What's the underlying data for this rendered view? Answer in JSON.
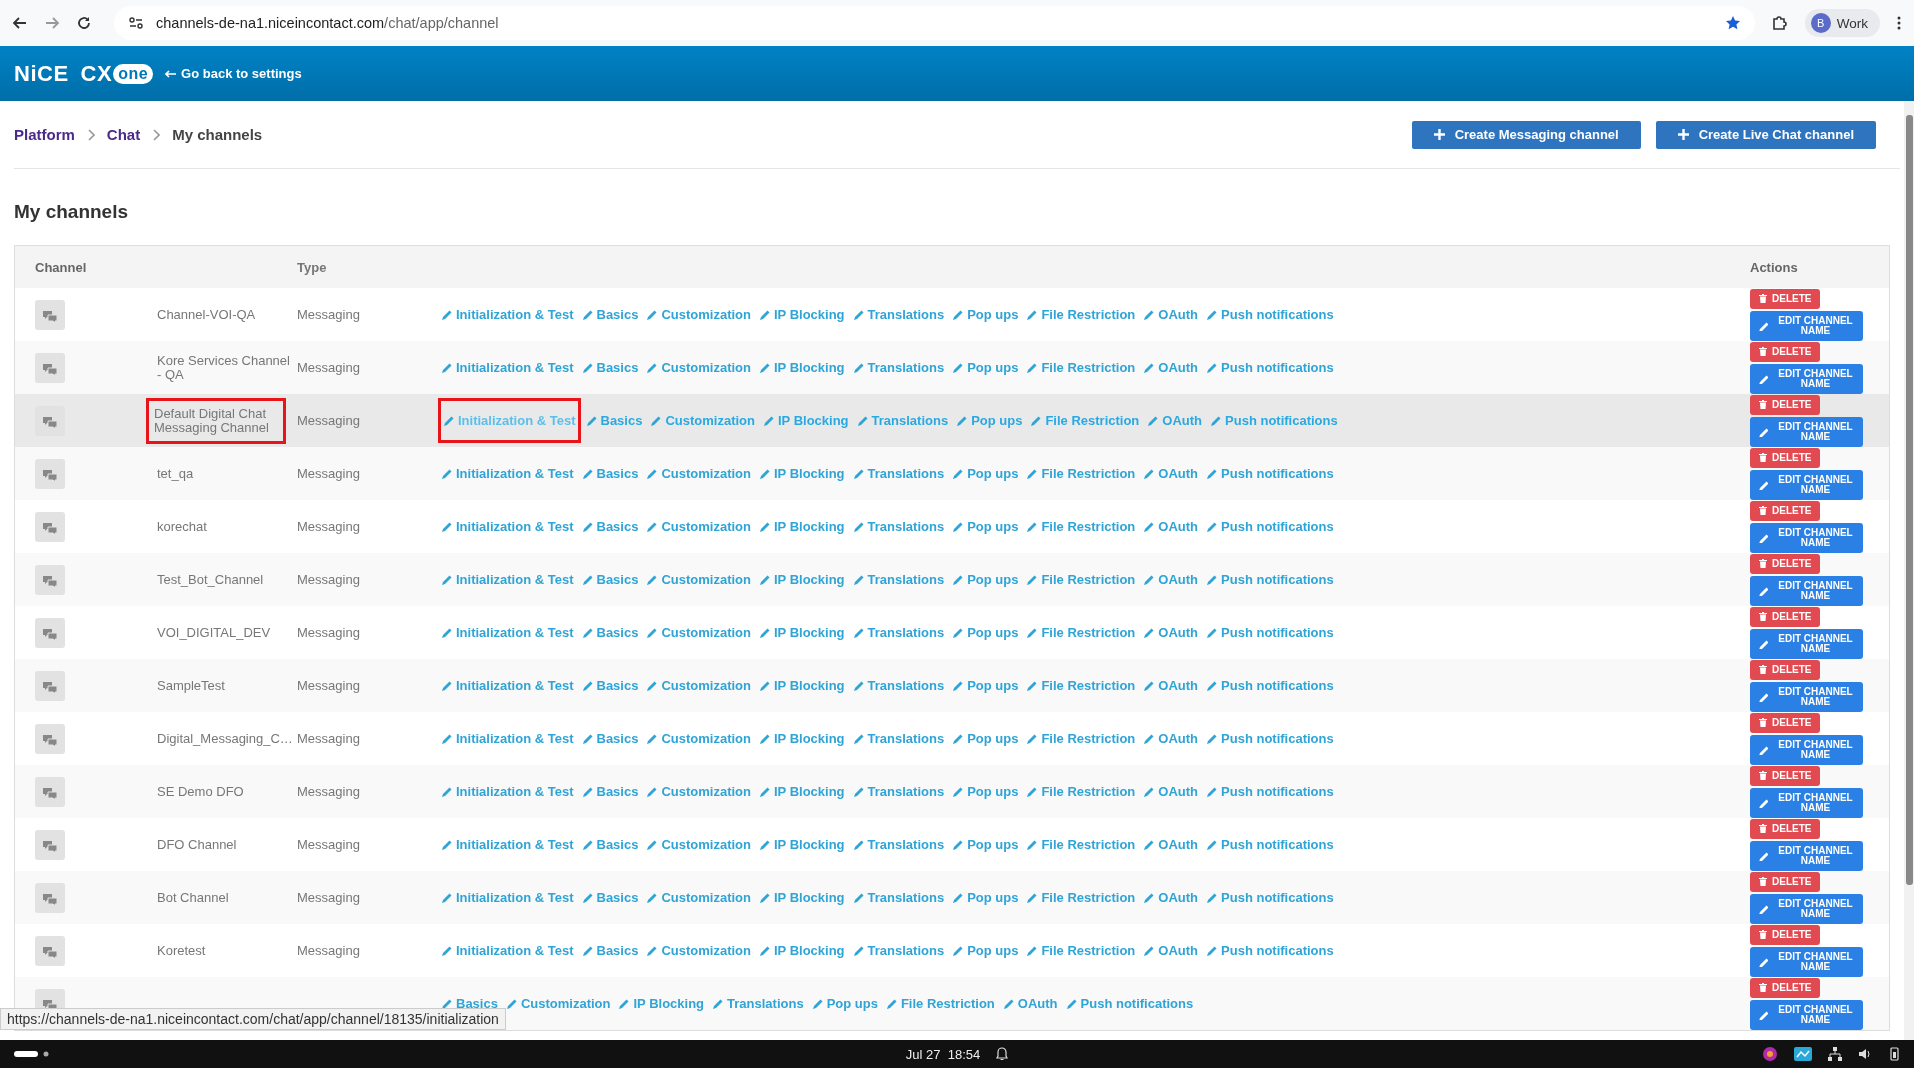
{
  "browser": {
    "url_host": "channels-de-na1.niceincontact.com",
    "url_path": "/chat/app/channel",
    "profile_initial": "B",
    "profile_name": "Work"
  },
  "header": {
    "logo_nice": "NiCE",
    "logo_cx": "CX",
    "logo_one": "one",
    "back_link": "Go back to settings"
  },
  "breadcrumb": [
    {
      "label": "Platform",
      "current": false
    },
    {
      "label": "Chat",
      "current": false
    },
    {
      "label": "My channels",
      "current": true
    }
  ],
  "create_buttons": [
    "Create Messaging channel",
    "Create Live Chat channel"
  ],
  "page_title": "My channels",
  "table": {
    "columns": [
      "Channel",
      "Type",
      "Actions"
    ],
    "rows": [
      {
        "name": "Channel-VOI-QA",
        "type": "Messaging",
        "hovered": false,
        "marked": false,
        "links": [
          "Initialization & Test",
          "Basics",
          "Customization",
          "IP Blocking",
          "Translations",
          "Pop ups",
          "File Restriction",
          "OAuth",
          "Push notifications"
        ],
        "delete": "DELETE",
        "edit": "EDIT CHANNEL NAME"
      },
      {
        "name": "Kore Services Channel - QA",
        "type": "Messaging",
        "hovered": false,
        "marked": false,
        "links": [
          "Initialization & Test",
          "Basics",
          "Customization",
          "IP Blocking",
          "Translations",
          "Pop ups",
          "File Restriction",
          "OAuth",
          "Push notifications"
        ],
        "delete": "DELETE",
        "edit": "EDIT CHANNEL NAME"
      },
      {
        "name": "Default Digital Chat Messaging Channel",
        "type": "Messaging",
        "hovered": true,
        "marked": true,
        "links": [
          "Initialization & Test",
          "Basics",
          "Customization",
          "IP Blocking",
          "Translations",
          "Pop ups",
          "File Restriction",
          "OAuth",
          "Push notifications"
        ],
        "delete": "DELETE",
        "edit": "EDIT CHANNEL NAME"
      },
      {
        "name": "tet_qa",
        "type": "Messaging",
        "hovered": false,
        "marked": false,
        "links": [
          "Initialization & Test",
          "Basics",
          "Customization",
          "IP Blocking",
          "Translations",
          "Pop ups",
          "File Restriction",
          "OAuth",
          "Push notifications"
        ],
        "delete": "DELETE",
        "edit": "EDIT CHANNEL NAME"
      },
      {
        "name": "korechat",
        "type": "Messaging",
        "hovered": false,
        "marked": false,
        "links": [
          "Initialization & Test",
          "Basics",
          "Customization",
          "IP Blocking",
          "Translations",
          "Pop ups",
          "File Restriction",
          "OAuth",
          "Push notifications"
        ],
        "delete": "DELETE",
        "edit": "EDIT CHANNEL NAME"
      },
      {
        "name": "Test_Bot_Channel",
        "type": "Messaging",
        "hovered": false,
        "marked": false,
        "links": [
          "Initialization & Test",
          "Basics",
          "Customization",
          "IP Blocking",
          "Translations",
          "Pop ups",
          "File Restriction",
          "OAuth",
          "Push notifications"
        ],
        "delete": "DELETE",
        "edit": "EDIT CHANNEL NAME"
      },
      {
        "name": "VOI_DIGITAL_DEV",
        "type": "Messaging",
        "hovered": false,
        "marked": false,
        "links": [
          "Initialization & Test",
          "Basics",
          "Customization",
          "IP Blocking",
          "Translations",
          "Pop ups",
          "File Restriction",
          "OAuth",
          "Push notifications"
        ],
        "delete": "DELETE",
        "edit": "EDIT CHANNEL NAME"
      },
      {
        "name": "SampleTest",
        "type": "Messaging",
        "hovered": false,
        "marked": false,
        "links": [
          "Initialization & Test",
          "Basics",
          "Customization",
          "IP Blocking",
          "Translations",
          "Pop ups",
          "File Restriction",
          "OAuth",
          "Push notifications"
        ],
        "delete": "DELETE",
        "edit": "EDIT CHANNEL NAME"
      },
      {
        "name": "Digital_Messaging_C…",
        "type": "Messaging",
        "hovered": false,
        "marked": false,
        "links": [
          "Initialization & Test",
          "Basics",
          "Customization",
          "IP Blocking",
          "Translations",
          "Pop ups",
          "File Restriction",
          "OAuth",
          "Push notifications"
        ],
        "delete": "DELETE",
        "edit": "EDIT CHANNEL NAME"
      },
      {
        "name": "SE Demo DFO",
        "type": "Messaging",
        "hovered": false,
        "marked": false,
        "links": [
          "Initialization & Test",
          "Basics",
          "Customization",
          "IP Blocking",
          "Translations",
          "Pop ups",
          "File Restriction",
          "OAuth",
          "Push notifications"
        ],
        "delete": "DELETE",
        "edit": "EDIT CHANNEL NAME"
      },
      {
        "name": "DFO Channel",
        "type": "Messaging",
        "hovered": false,
        "marked": false,
        "links": [
          "Initialization & Test",
          "Basics",
          "Customization",
          "IP Blocking",
          "Translations",
          "Pop ups",
          "File Restriction",
          "OAuth",
          "Push notifications"
        ],
        "delete": "DELETE",
        "edit": "EDIT CHANNEL NAME"
      },
      {
        "name": "Bot Channel",
        "type": "Messaging",
        "hovered": false,
        "marked": false,
        "links": [
          "Initialization & Test",
          "Basics",
          "Customization",
          "IP Blocking",
          "Translations",
          "Pop ups",
          "File Restriction",
          "OAuth",
          "Push notifications"
        ],
        "delete": "DELETE",
        "edit": "EDIT CHANNEL NAME"
      },
      {
        "name": "Koretest",
        "type": "Messaging",
        "hovered": false,
        "marked": false,
        "links": [
          "Initialization & Test",
          "Basics",
          "Customization",
          "IP Blocking",
          "Translations",
          "Pop ups",
          "File Restriction",
          "OAuth",
          "Push notifications"
        ],
        "delete": "DELETE",
        "edit": "EDIT CHANNEL NAME"
      },
      {
        "hovered": false,
        "marked": false,
        "links": [
          "Basics",
          "Customization",
          "IP Blocking",
          "Translations",
          "Pop ups",
          "File Restriction",
          "OAuth",
          "Push notifications"
        ],
        "delete": "DELETE",
        "edit": "EDIT CHANNEL NAME"
      }
    ]
  },
  "status_url": "https://channels-de-na1.niceincontact.com/chat/app/channel/18135/initialization",
  "taskbar": {
    "date": "Jul 27",
    "time": "18:54"
  }
}
